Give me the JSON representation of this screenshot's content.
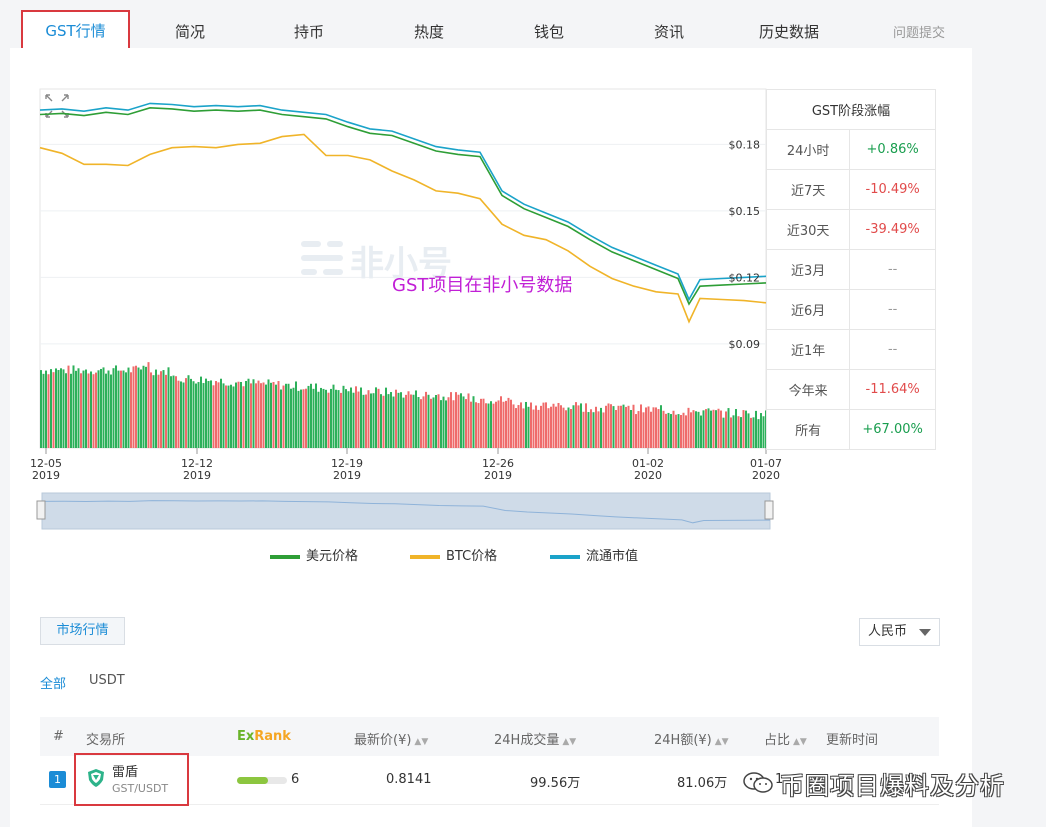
{
  "tabs": [
    "GST行情",
    "简况",
    "持币",
    "热度",
    "钱包",
    "资讯",
    "历史数据"
  ],
  "report_link": "问题提交",
  "overlay_text": "GST项目在非小号数据",
  "watermark_logo": "非小号",
  "range_table": {
    "title": "GST阶段涨幅",
    "rows": [
      {
        "label": "24小时",
        "value": "+0.86%",
        "status": "pos"
      },
      {
        "label": "近7天",
        "value": "-10.49%",
        "status": "neg"
      },
      {
        "label": "近30天",
        "value": "-39.49%",
        "status": "neg"
      },
      {
        "label": "近3月",
        "value": "--",
        "status": "na"
      },
      {
        "label": "近6月",
        "value": "--",
        "status": "na"
      },
      {
        "label": "近1年",
        "value": "--",
        "status": "na"
      },
      {
        "label": "今年来",
        "value": "-11.64%",
        "status": "neg"
      },
      {
        "label": "所有",
        "value": "+67.00%",
        "status": "pos"
      }
    ]
  },
  "legend": [
    "美元价格",
    "BTC价格",
    "流通市值"
  ],
  "market": {
    "button": "市场行情",
    "currency": "人民币",
    "filters": [
      "全部",
      "USDT"
    ],
    "headers": {
      "index": "#",
      "exchange": "交易所",
      "exrank_a": "Ex",
      "exrank_b": "Rank",
      "price": "最新价(¥)",
      "volume": "24H成交量",
      "amount": "24H额(¥)",
      "share": "占比",
      "updated": "更新时间"
    },
    "row": {
      "rank": "1",
      "exchange": "雷盾",
      "pair": "GST/USDT",
      "score": "6",
      "price": "0.8141",
      "volume": "99.56万",
      "amount": "81.06万",
      "share": "1"
    }
  },
  "watermark": "币圈项目爆料及分析",
  "chart_data": {
    "type": "line",
    "x_ticks": [
      {
        "date": "12-05",
        "year": "2019"
      },
      {
        "date": "12-12",
        "year": "2019"
      },
      {
        "date": "12-19",
        "year": "2019"
      },
      {
        "date": "12-26",
        "year": "2019"
      },
      {
        "date": "01-02",
        "year": "2020"
      },
      {
        "date": "01-07",
        "year": "2020"
      }
    ],
    "y_ticks": [
      "$0.18",
      "$0.15",
      "$0.12",
      "$0.09"
    ],
    "ylim": [
      0.08,
      0.205
    ],
    "x_range_days": [
      0,
      33
    ],
    "series": [
      {
        "name": "美元价格",
        "color": "#2e9e36",
        "points": [
          [
            0,
            0.1935
          ],
          [
            1,
            0.194
          ],
          [
            2,
            0.193
          ],
          [
            3,
            0.1945
          ],
          [
            4,
            0.1935
          ],
          [
            5,
            0.1965
          ],
          [
            6,
            0.196
          ],
          [
            7,
            0.195
          ],
          [
            8,
            0.1955
          ],
          [
            9,
            0.195
          ],
          [
            10,
            0.1955
          ],
          [
            11,
            0.1935
          ],
          [
            12,
            0.1925
          ],
          [
            13,
            0.1915
          ],
          [
            14,
            0.188
          ],
          [
            15,
            0.185
          ],
          [
            16,
            0.184
          ],
          [
            17,
            0.1805
          ],
          [
            18,
            0.177
          ],
          [
            19,
            0.1755
          ],
          [
            20,
            0.1745
          ],
          [
            21,
            0.157
          ],
          [
            22,
            0.151
          ],
          [
            23,
            0.147
          ],
          [
            24,
            0.143
          ],
          [
            25,
            0.137
          ],
          [
            26,
            0.1315
          ],
          [
            27,
            0.1275
          ],
          [
            28,
            0.1235
          ],
          [
            29,
            0.1195
          ],
          [
            29.5,
            0.108
          ],
          [
            30,
            0.116
          ],
          [
            31,
            0.1165
          ],
          [
            32,
            0.117
          ],
          [
            33,
            0.1175
          ]
        ]
      },
      {
        "name": "BTC价格",
        "color": "#f0b429",
        "points": [
          [
            0,
            0.1785
          ],
          [
            1,
            0.176
          ],
          [
            2,
            0.171
          ],
          [
            3,
            0.171
          ],
          [
            4,
            0.1705
          ],
          [
            5,
            0.1755
          ],
          [
            6,
            0.1785
          ],
          [
            7,
            0.179
          ],
          [
            8,
            0.1785
          ],
          [
            9,
            0.18
          ],
          [
            10,
            0.1805
          ],
          [
            11,
            0.1835
          ],
          [
            12,
            0.1845
          ],
          [
            13,
            0.175
          ],
          [
            14,
            0.175
          ],
          [
            15,
            0.173
          ],
          [
            16,
            0.168
          ],
          [
            17,
            0.164
          ],
          [
            18,
            0.159
          ],
          [
            19,
            0.158
          ],
          [
            20,
            0.1555
          ],
          [
            21,
            0.144
          ],
          [
            22,
            0.139
          ],
          [
            23,
            0.137
          ],
          [
            24,
            0.132
          ],
          [
            25,
            0.125
          ],
          [
            26,
            0.1195
          ],
          [
            27,
            0.116
          ],
          [
            28,
            0.1135
          ],
          [
            29,
            0.1125
          ],
          [
            29.5,
            0.1
          ],
          [
            30,
            0.1105
          ],
          [
            31,
            0.11
          ],
          [
            32,
            0.1095
          ],
          [
            33,
            0.1085
          ]
        ]
      },
      {
        "name": "流通市值",
        "color": "#1ba3c9",
        "points": [
          [
            0,
            0.1955
          ],
          [
            1,
            0.196
          ],
          [
            2,
            0.195
          ],
          [
            3,
            0.1965
          ],
          [
            4,
            0.1955
          ],
          [
            5,
            0.1985
          ],
          [
            6,
            0.198
          ],
          [
            7,
            0.197
          ],
          [
            8,
            0.1975
          ],
          [
            9,
            0.197
          ],
          [
            10,
            0.1975
          ],
          [
            11,
            0.1955
          ],
          [
            12,
            0.1945
          ],
          [
            13,
            0.1935
          ],
          [
            14,
            0.19
          ],
          [
            15,
            0.187
          ],
          [
            16,
            0.186
          ],
          [
            17,
            0.1825
          ],
          [
            18,
            0.179
          ],
          [
            19,
            0.1775
          ],
          [
            20,
            0.1765
          ],
          [
            21,
            0.159
          ],
          [
            22,
            0.153
          ],
          [
            23,
            0.149
          ],
          [
            24,
            0.145
          ],
          [
            25,
            0.139
          ],
          [
            26,
            0.1335
          ],
          [
            27,
            0.1295
          ],
          [
            28,
            0.1255
          ],
          [
            29,
            0.1215
          ],
          [
            29.5,
            0.11
          ],
          [
            30,
            0.119
          ],
          [
            31,
            0.1195
          ],
          [
            32,
            0.12
          ],
          [
            33,
            0.1205
          ]
        ]
      }
    ],
    "volume_bars": "green/red histogram below price chart (unlabeled)"
  }
}
